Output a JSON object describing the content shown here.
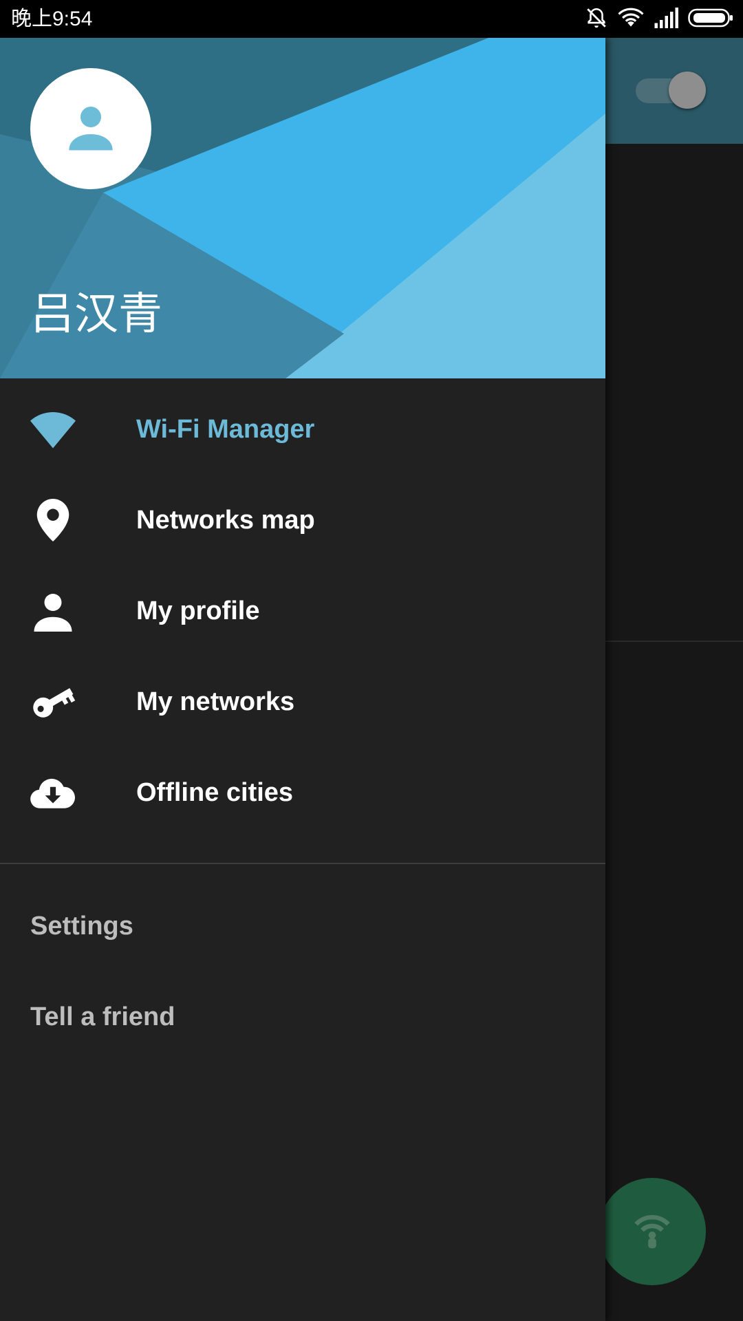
{
  "status_bar": {
    "time": "晚上9:54",
    "icons": [
      "mute-icon",
      "wifi-icon",
      "signal-icon",
      "battery-icon"
    ]
  },
  "drawer": {
    "user_name": "吕汉青",
    "menu_items": [
      {
        "label": "Wi-Fi Manager",
        "icon": "wifi-icon",
        "active": true
      },
      {
        "label": "Networks map",
        "icon": "location-pin-icon",
        "active": false
      },
      {
        "label": "My profile",
        "icon": "person-icon",
        "active": false
      },
      {
        "label": "My networks",
        "icon": "key-icon",
        "active": false
      },
      {
        "label": "Offline cities",
        "icon": "cloud-download-icon",
        "active": false
      }
    ],
    "secondary_items": [
      {
        "label": "Settings"
      },
      {
        "label": "Tell a friend"
      }
    ]
  },
  "colors": {
    "accent": "#6cbad7",
    "drawer_bg": "#212121",
    "toolbar": "#2a5866",
    "fab": "#1f5c3f"
  }
}
